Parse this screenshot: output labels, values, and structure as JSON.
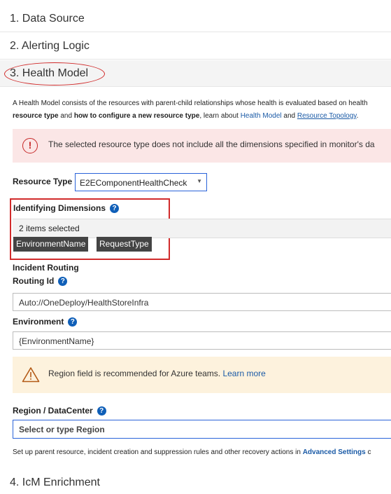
{
  "sections": {
    "s1": "1. Data Source",
    "s2": "2. Alerting Logic",
    "s3": "3. Health Model",
    "s4": "4. IcM Enrichment"
  },
  "description": {
    "part1": "A Health Model consists of the resources with parent-child relationships whose health is evaluated based on health",
    "bold1": "resource type",
    "part2": " and ",
    "bold2": "how to configure a new resource type",
    "part3": ", learn about ",
    "link1": "Health Model",
    "part4": " and ",
    "link2": "Resource Topology",
    "part5": "."
  },
  "error_alert": {
    "icon": "error-circle-icon",
    "message": "The selected resource type does not include all the dimensions specified in monitor's da"
  },
  "resource_type": {
    "label": "Resource Type",
    "value": "E2EComponentHealthCheck"
  },
  "identifying_dimensions": {
    "label": "Identifying Dimensions",
    "selected_text": "2 items selected",
    "tags": [
      "EnvironmentName",
      "RequestType"
    ]
  },
  "incident_routing": {
    "label": "Incident Routing",
    "routing_id_label": "Routing Id",
    "routing_id_value": "Auto://OneDeploy/HealthStoreInfra",
    "environment_label": "Environment",
    "environment_value": "{EnvironmentName}"
  },
  "warning_alert": {
    "icon": "warning-triangle-icon",
    "message": "Region field is recommended for Azure teams. ",
    "link": "Learn more"
  },
  "region": {
    "label": "Region / DataCenter",
    "placeholder": "Select or type Region"
  },
  "footer": {
    "text": "Set up parent resource, incident creation and suppression rules and other recovery actions in ",
    "link": "Advanced Settings",
    "tail": " c"
  },
  "help_glyph": "?",
  "colors": {
    "accent_blue": "#2a63d9",
    "link_blue": "#1a5aa6",
    "error_bg": "#fbe6e6",
    "warn_bg": "#fdf2dd",
    "highlight_red": "#d12b2b"
  }
}
